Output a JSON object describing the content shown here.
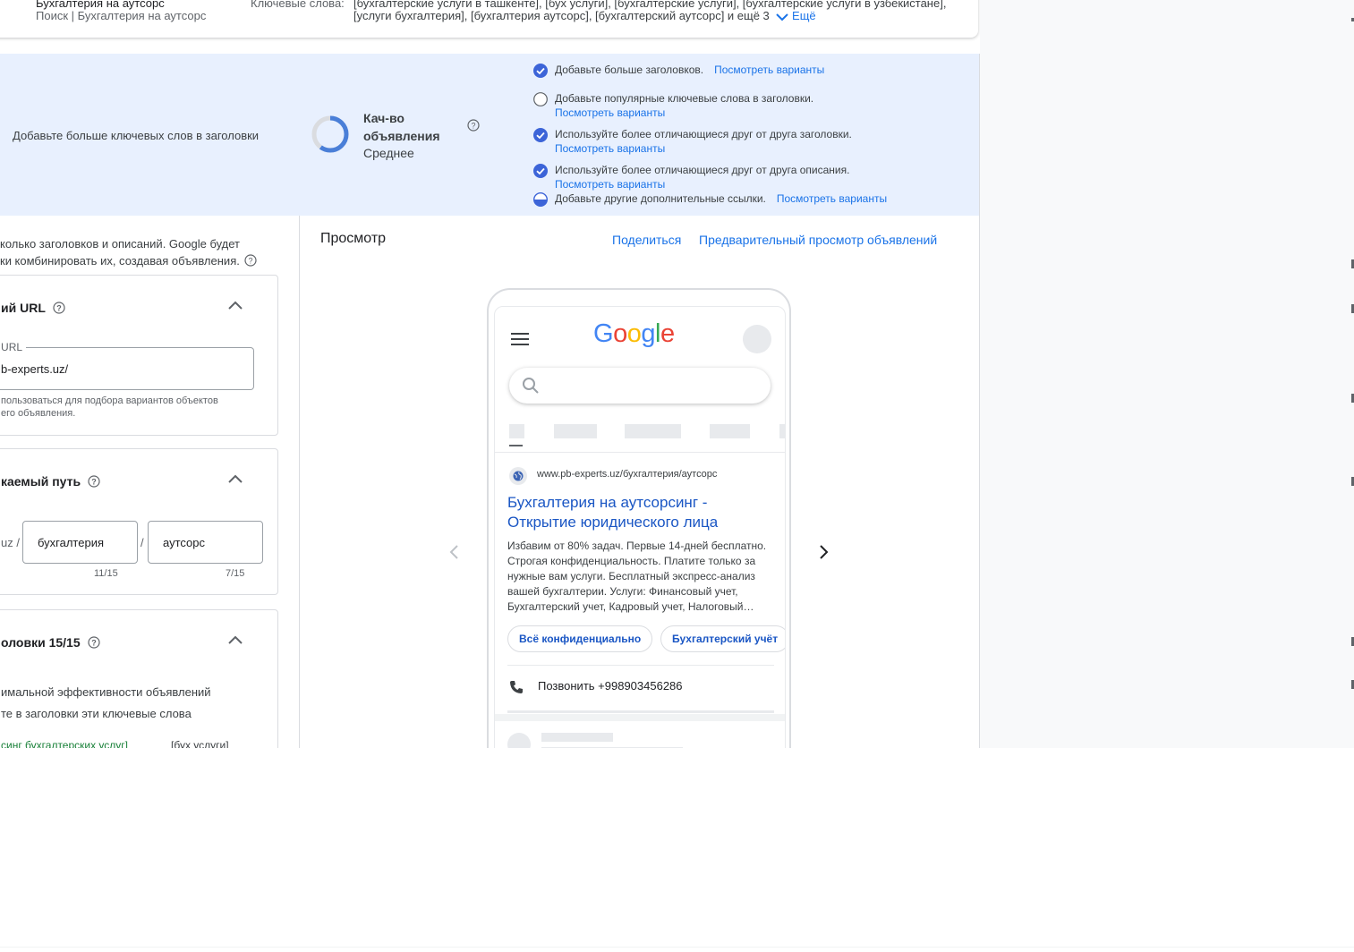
{
  "summary": {
    "line1": "Бухгалтерия на аутсорс",
    "line2": "Поиск | Бухгалтерия на аутсорс",
    "keywords_label": "Ключевые слова:",
    "keywords_line1": "[бухгалтерские услуги в ташкенте], [бух услуги], [бухгалтерские услуги], [бухгалтерские услуги в узбекистане],",
    "keywords_line2": "[услуги бухгалтерия], [бухгалтерия аутсорс], [бухгалтерский аутсорс] и ещё 3",
    "more_label": "Ещё"
  },
  "quality": {
    "tip": "Добавьте больше ключевых слов в заголовки",
    "title": "Кач-во объявления",
    "value": "Среднее",
    "level": 0.6,
    "suggestions": [
      {
        "text": "Добавьте больше заголовков.",
        "link": "Посмотреть варианты",
        "status": "done"
      },
      {
        "text": "Добавьте популярные ключевые слова в заголовки.",
        "link": "Посмотреть варианты",
        "status": "empty"
      },
      {
        "text": "Используйте более отличающиеся друг от друга заголовки.",
        "link": "Посмотреть варианты",
        "status": "done"
      },
      {
        "text": "Используйте более отличающиеся друг от друга описания.",
        "link": "Посмотреть варианты",
        "status": "done"
      },
      {
        "text": "Добавьте другие дополнительные ссылки.",
        "link": "Посмотреть варианты",
        "status": "half"
      }
    ]
  },
  "left": {
    "intro_line1": "колько заголовков и описаний. Google будет",
    "intro_line2": "ки комбинировать их, создавая объявления.",
    "url_card": {
      "header": "ий URL",
      "field_label": "й URL",
      "field_value": "b-experts.uz/",
      "hint_line1": "пользоваться для подбора вариантов объектов",
      "hint_line2": "его объявления."
    },
    "path_card": {
      "header": "каемый путь",
      "prefix": "uz /",
      "path1": "бухгалтерия",
      "sep": "/",
      "path2": "аутсорс",
      "count1": "11/15",
      "count2": "7/15"
    },
    "headlines_card": {
      "header": "оловки 15/15",
      "text1": "имальной эффективности объявлений",
      "text2": "те в заголовки эти ключевые слова",
      "kw_green": "синг бухгалтерских услуг]",
      "kw2": "[бух услуги]"
    }
  },
  "preview": {
    "title": "Просмотр",
    "share": "Поделиться",
    "full_preview": "Предварительный просмотр объявлений",
    "logo": "Google",
    "ad": {
      "url": "www.pb-experts.uz/бухгалтерия/аутсорс",
      "title_line1": "Бухгалтерия на аутсорсинг -",
      "title_line2": "Открытие юридического лица",
      "desc": "Избавим от 80% задач. Первые 14-дней бесплатно. Строгая конфиденциальность. Платите только за нужные вам услуги. Бесплатный экспресс-анализ вашей бухгалтерии. Услуги: Финансовый учет, Бухгалтерский учет, Кадровый учет, Налоговый…",
      "chip1": "Всё конфиденциально",
      "chip2": "Бухгалтерский учёт",
      "call": "Позвонить +998903456286"
    }
  },
  "colors": {
    "accent": "#1a73e8",
    "panel_bg": "#e8f0fe",
    "ad_title": "#1a56c4",
    "keyword_green": "#188038"
  }
}
